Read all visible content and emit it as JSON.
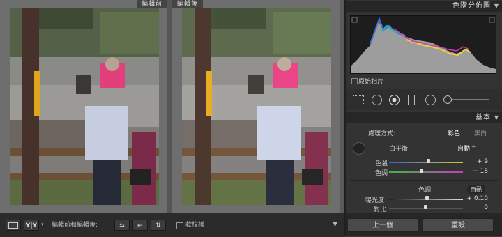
{
  "compare": {
    "before_label": "編輯前",
    "after_label": "編輯後"
  },
  "toolbar": {
    "view_loupe_icon": "single-view-icon",
    "view_yy_label": "Y|Y",
    "compare_label": "編輯前和編輯後:",
    "soft_proof_label": "軟校樣"
  },
  "histogram": {
    "title": "色階分佈圖",
    "original_photo_label": "原始相片"
  },
  "basic": {
    "title": "基本",
    "treatment_label": "處理方式:",
    "color_option": "彩色",
    "bw_option": "黑白",
    "wb_label": "白平衡:",
    "wb_value": "自動",
    "temp_label": "色溫",
    "temp_value": "+ 9",
    "tint_label": "色調",
    "tint_value": "− 18",
    "tone_label": "色調",
    "tone_auto": "自動",
    "exposure_label": "曝光度",
    "exposure_value": "+ 0.10",
    "contrast_label": "對比",
    "contrast_value": "0"
  },
  "buttons": {
    "previous": "上一個",
    "reset": "重設"
  }
}
